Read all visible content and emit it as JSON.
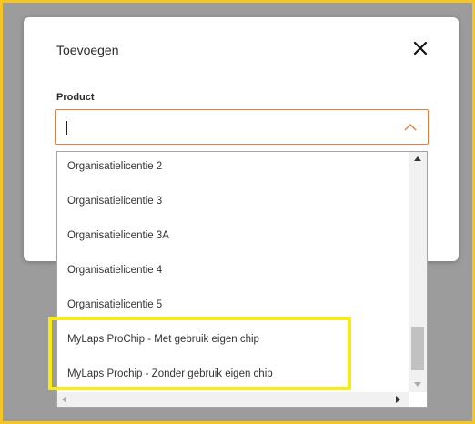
{
  "dialog": {
    "title": "Toevoegen",
    "field_label": "Product",
    "input_value": ""
  },
  "icons": {
    "close": "close-icon",
    "dropdown_toggle": "chevron-up-icon",
    "scroll_up": "triangle-up-icon",
    "scroll_down": "triangle-down-icon",
    "scroll_left": "triangle-left-icon",
    "scroll_right": "triangle-right-icon"
  },
  "dropdown": {
    "options": [
      {
        "label": "Organisatielicentie 2"
      },
      {
        "label": "Organisatielicentie 3"
      },
      {
        "label": "Organisatielicentie 3A"
      },
      {
        "label": "Organisatielicentie 4"
      },
      {
        "label": "Organisatielicentie 5"
      },
      {
        "label": "MyLaps ProChip - Met gebruik eigen chip"
      },
      {
        "label": "MyLaps Prochip - Zonder gebruik eigen chip"
      }
    ]
  },
  "colors": {
    "input_border_focus": "#f07a3d",
    "highlight": "#f6ec14",
    "frame_border": "#f6c425",
    "backdrop": "#9c9c9c"
  }
}
